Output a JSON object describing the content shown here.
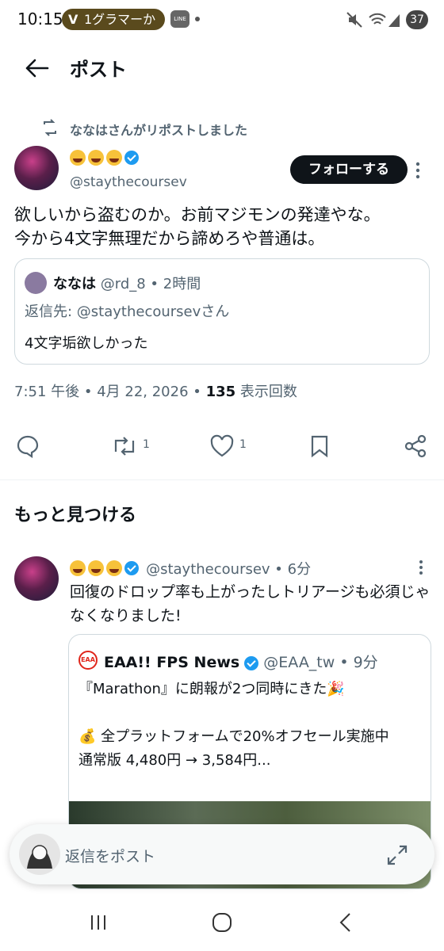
{
  "status": {
    "time": "10:15",
    "pill_text": "1グラマーか",
    "pill_logo": "V",
    "line_badge": "LINE",
    "battery": "37"
  },
  "header": {
    "title": "ポスト"
  },
  "repost": {
    "text": "ななはさんがリポストしました"
  },
  "post": {
    "handle": "@staythecoursev",
    "follow_label": "フォローする",
    "body_line1": "欲しいから盗むのか。お前マジモンの発達やな。",
    "body_line2": "今から4文字無理だから諦めろや普通は。",
    "quote": {
      "name": "ななは",
      "handle_time": "@rd_8 • 2時間",
      "reply_to": "返信先: @staythecoursevさん",
      "text": "4文字垢欲しかった"
    },
    "meta_prefix": "7:51 午後 • 4月 22, 2026 • ",
    "views_count": "135",
    "views_label": " 表示回数",
    "retweet_count": "1",
    "like_count": "1"
  },
  "discover": {
    "title": "もっと見つける"
  },
  "post2": {
    "handle_time": "@staythecoursev • 6分",
    "body": "回復のドロップ率も上がったしトリアージも必須じゃなくなりました!",
    "card": {
      "logo_text": "EAA",
      "name": "EAA!! FPS News",
      "handle_time": "@EAA_tw • 9分",
      "line1": "『Marathon』に朗報が2つ同時にきた🎉",
      "line2": "💰 全プラットフォームで20%オフセール実施中",
      "line3": "通常版 4,480円 → 3,584円..."
    }
  },
  "reply": {
    "placeholder": "返信をポスト"
  },
  "colors": {
    "accent": "#1d9bf0",
    "text": "#0f1419",
    "muted": "#536471"
  },
  "icons": [
    "back-arrow-icon",
    "repost-icon",
    "verified-icon",
    "reply-icon",
    "retweet-icon",
    "like-icon",
    "bookmark-icon",
    "share-icon",
    "more-icon",
    "expand-icon",
    "recent-apps-icon",
    "home-icon",
    "nav-back-icon"
  ]
}
